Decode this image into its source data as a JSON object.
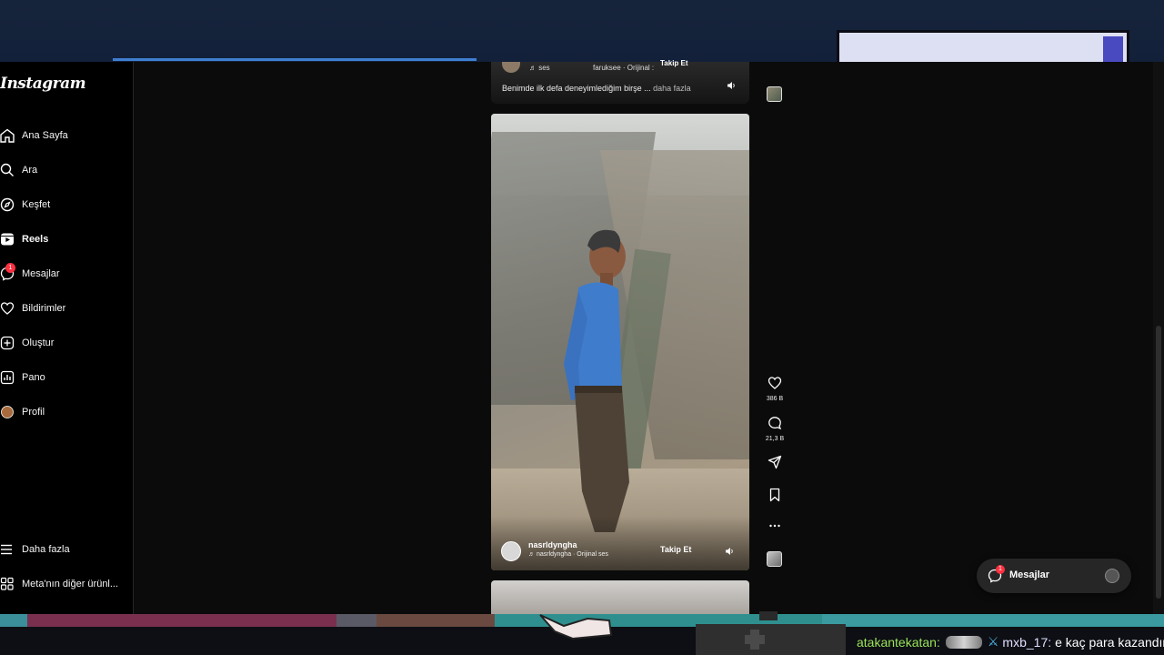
{
  "app": {
    "logo": "Instagram"
  },
  "sidebar": {
    "items": [
      {
        "label": "Ana Sayfa",
        "icon": "home-icon"
      },
      {
        "label": "Ara",
        "icon": "search-icon"
      },
      {
        "label": "Keşfet",
        "icon": "compass-icon"
      },
      {
        "label": "Reels",
        "icon": "reels-icon",
        "active": true
      },
      {
        "label": "Mesajlar",
        "icon": "messenger-icon",
        "badge": "1"
      },
      {
        "label": "Bildirimler",
        "icon": "heart-icon"
      },
      {
        "label": "Oluştur",
        "icon": "plus-square-icon"
      },
      {
        "label": "Pano",
        "icon": "dashboard-icon"
      },
      {
        "label": "Profil",
        "icon": "avatar-icon"
      }
    ],
    "bottom_items": [
      {
        "label": "Daha fazla",
        "icon": "menu-icon"
      },
      {
        "label": "Meta'nın diğer ürünl...",
        "icon": "grid-icon"
      }
    ]
  },
  "previous_reel": {
    "audio": "ses",
    "audio_source": "faruksee · Orijinal :",
    "follow": "Takip Et",
    "caption": "Benimde ilk defa deneyimlediğim birşe ...",
    "more": "daha fazla"
  },
  "current_reel": {
    "username": "nasrldyngha",
    "audio": "nasrldyngha · Orijinal ses",
    "follow": "Takip Et",
    "likes": "386 B",
    "comments": "21,3 B"
  },
  "messages_pill": {
    "label": "Mesajlar",
    "badge": "1"
  },
  "stream_chat": {
    "user1": "atakantekatan:",
    "user2": "mxb_17:",
    "message": "e kaç para kazandın"
  },
  "colors": {
    "accent": "#ff3040",
    "background": "#0b0b0b",
    "sidebar": "#000000",
    "chat_user1": "#9be35a"
  }
}
